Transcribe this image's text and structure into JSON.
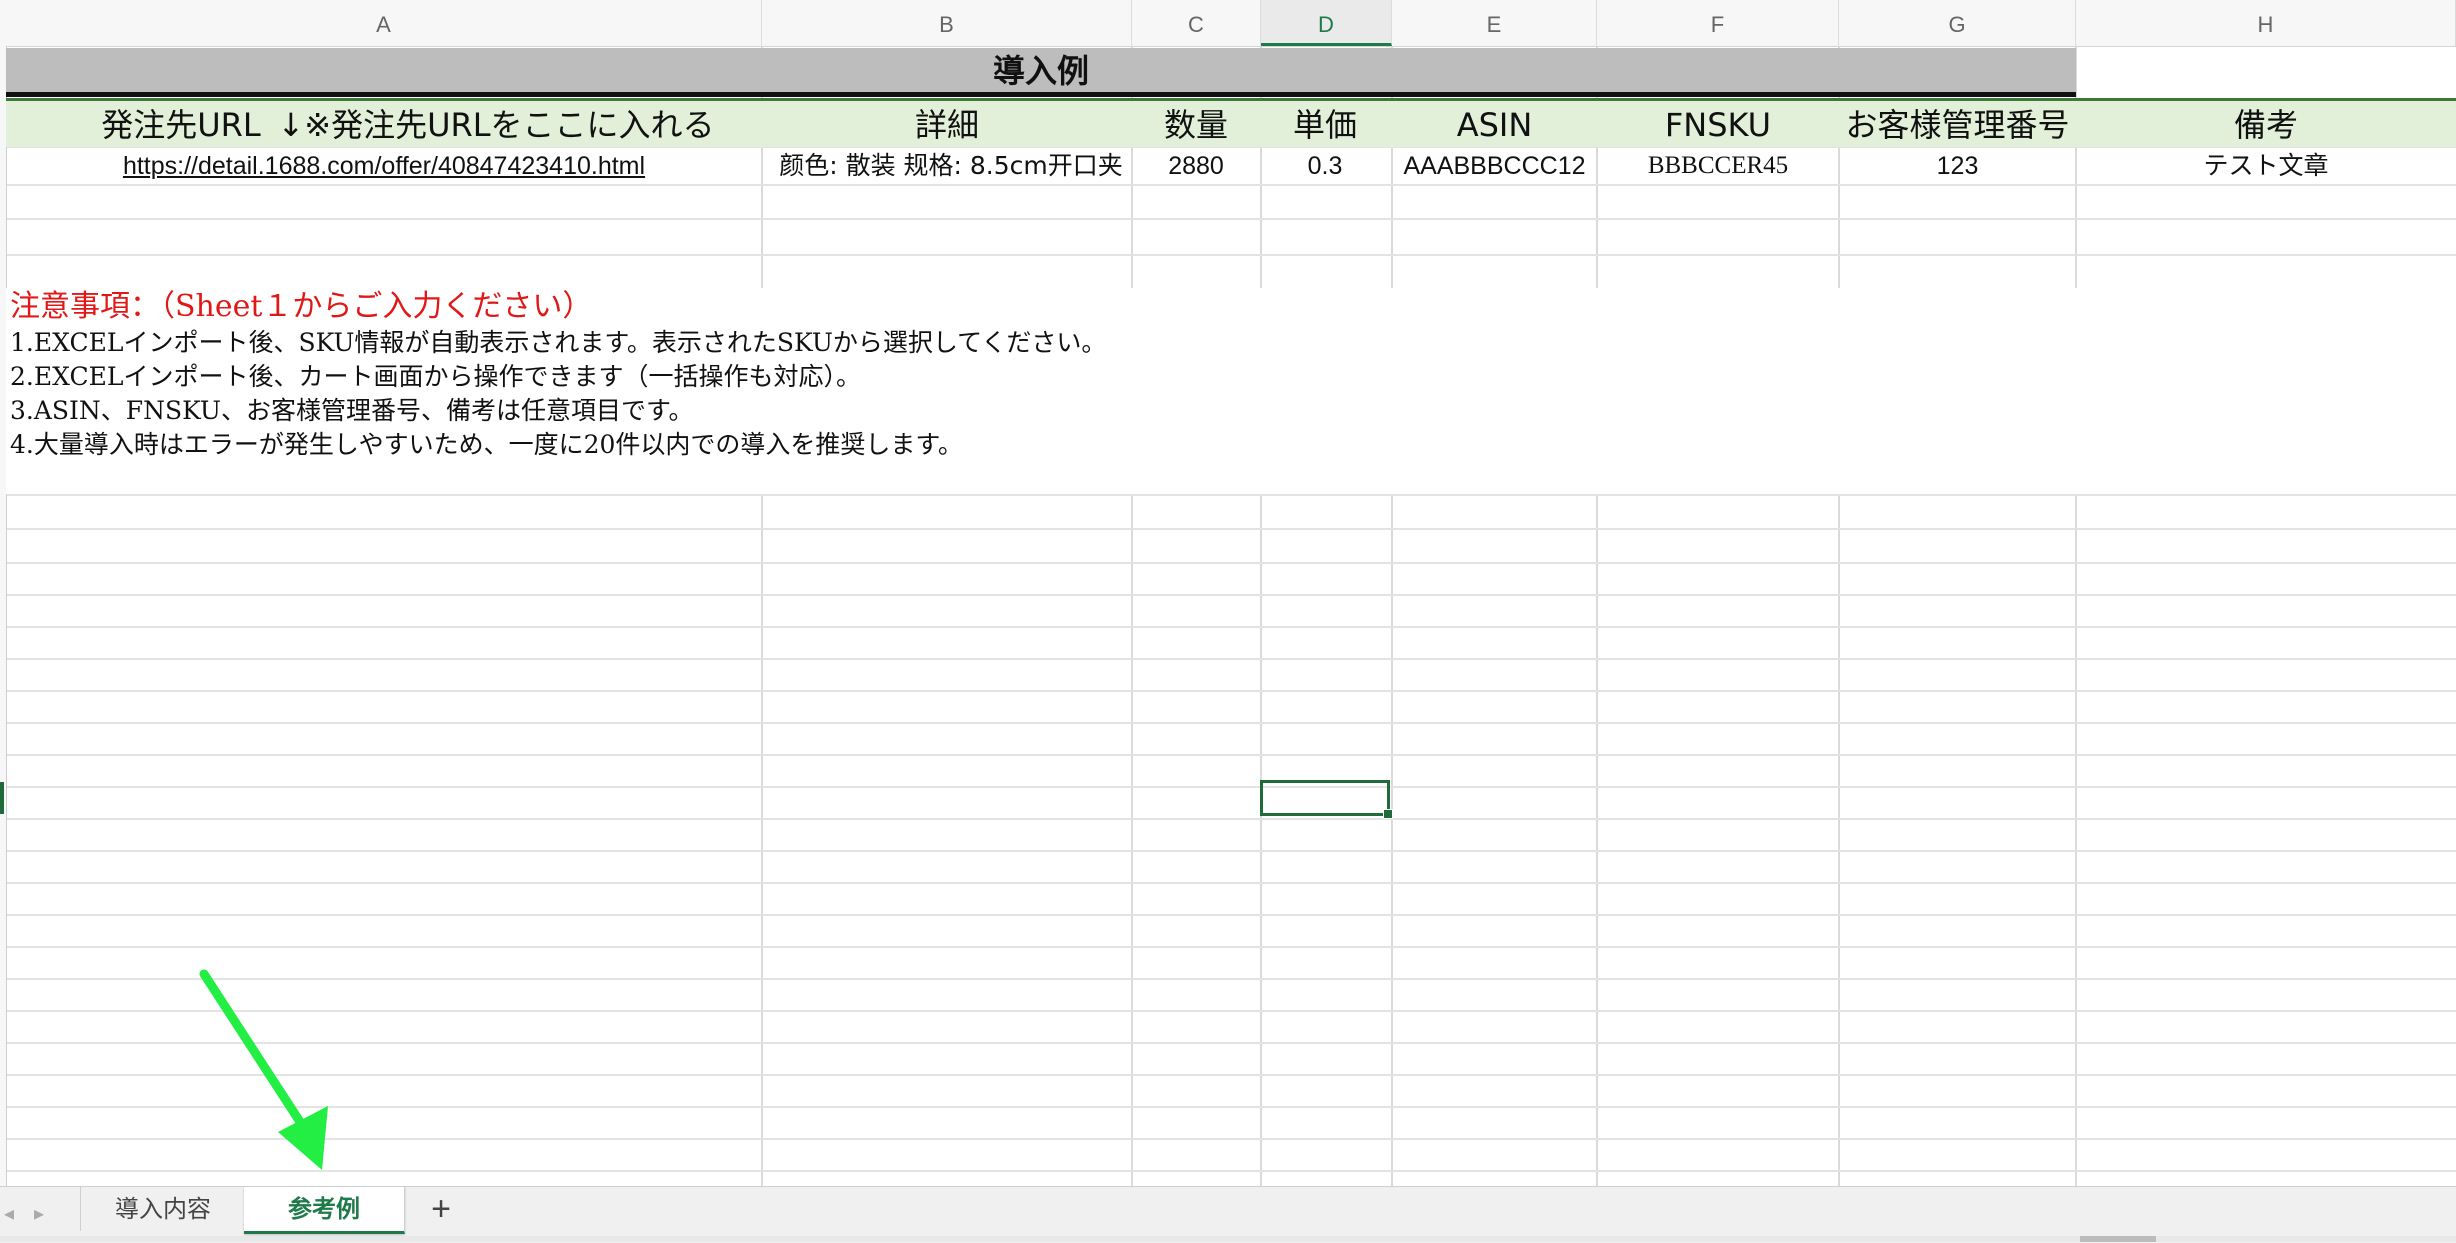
{
  "columns": [
    "A",
    "B",
    "C",
    "D",
    "E",
    "F",
    "G",
    "H"
  ],
  "selected_column": "D",
  "sheet_title": "導入例",
  "header": {
    "url": "発注先URL",
    "url_hint": "↓※発注先URLをここに入れる",
    "detail": "詳細",
    "qty": "数量",
    "price": "単価",
    "asin": "ASIN",
    "fnsku": "FNSKU",
    "customer_no": "お客様管理番号",
    "note": "備考"
  },
  "row1": {
    "url": "https://detail.1688.com/offer/40847423410.html",
    "detail": "颜色: 散装 规格: 8.5cm开口夹",
    "qty": "2880",
    "price": "0.3",
    "asin": "AAABBBCCC12",
    "fnsku": "BBBCCER45",
    "customer_no": "123",
    "note": "テスト文章"
  },
  "notes": {
    "title": "注意事項：（Sheet１からご入力ください）",
    "lines": [
      "1.EXCELインポート後、SKU情報が自動表示されます。表示されたSKUから選択してください。",
      "2.EXCELインポート後、カート画面から操作できます（一括操作も対応）。",
      "3.ASIN、FNSKU、お客様管理番号、備考は任意項目です。",
      "4.大量導入時はエラーが発生しやすいため、一度に20件以内での導入を推奨します。"
    ]
  },
  "tabs": [
    {
      "label": "導入内容",
      "active": false
    },
    {
      "label": "参考例",
      "active": true
    }
  ],
  "add_tab_label": "+",
  "nav_prev": "◂",
  "nav_next": "▸",
  "colors": {
    "accent": "#1f7a4a",
    "header_bg": "#e2f0d9",
    "title_bg": "#bdbdbd",
    "note_title": "#e01818",
    "link": "#1155cc",
    "arrow": "#22ee44"
  }
}
